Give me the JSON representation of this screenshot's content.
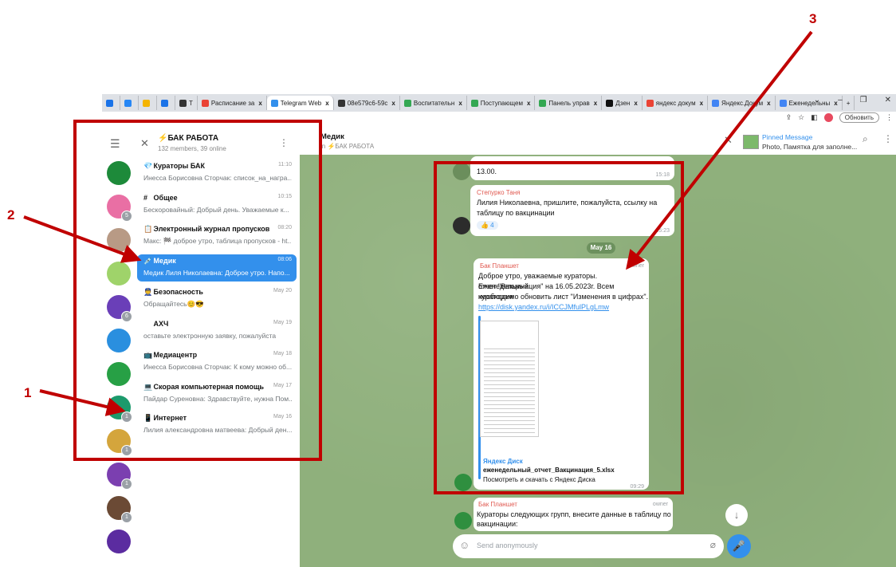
{
  "browser": {
    "tabs": [
      {
        "label": "",
        "color": "#1a73e8"
      },
      {
        "label": "",
        "color": "#2787f5"
      },
      {
        "label": "",
        "color": "#f4b400"
      },
      {
        "label": "",
        "color": "#1a73e8"
      },
      {
        "label": "T",
        "color": "#333333"
      },
      {
        "label": "Расписание за",
        "color": "#ea4335"
      },
      {
        "label": "Telegram Web",
        "color": "#3390ec",
        "active": true
      },
      {
        "label": "08e579c6-59c",
        "color": "#333333"
      },
      {
        "label": "Воспитательн",
        "color": "#34a853"
      },
      {
        "label": "Поступающем",
        "color": "#34a853"
      },
      {
        "label": "Панель управ",
        "color": "#34a853"
      },
      {
        "label": "Дзен",
        "color": "#111111"
      },
      {
        "label": "яндекс докум",
        "color": "#ea4335"
      },
      {
        "label": "Яндекс.Докум",
        "color": "#4285f4"
      },
      {
        "label": "Еженедельны",
        "color": "#4285f4"
      }
    ],
    "new_tab": "+",
    "update_label": "Обновить"
  },
  "sidebar": {
    "avatars": [
      {
        "color": "#1d8a3a",
        "badge": ""
      },
      {
        "color": "#e96fa4",
        "badge": "5"
      },
      {
        "color": "#b89a85",
        "badge": ""
      },
      {
        "color": "#9fd36a",
        "badge": ""
      },
      {
        "color": "#6a3fb8",
        "badge": "6"
      },
      {
        "color": "#2a8fdf",
        "badge": ""
      },
      {
        "color": "#27a045",
        "badge": ""
      },
      {
        "color": "#1c9a6c",
        "badge": "1"
      },
      {
        "color": "#d4a53c",
        "badge": "1"
      },
      {
        "color": "#7b3fb0",
        "badge": "1"
      },
      {
        "color": "#6b4a35",
        "badge": "1"
      },
      {
        "color": "#5b2ca0",
        "badge": ""
      }
    ]
  },
  "group": {
    "title": "⚡БАК РАБОТА",
    "subtitle": "132 members, 39 online"
  },
  "chats": [
    {
      "icon": "💎",
      "name": "Кураторы БАК",
      "time": "11:10",
      "preview": "Инесса Борисовна Сторчак: список_на_награ..."
    },
    {
      "icon": "#",
      "name": "Общее",
      "time": "10:15",
      "preview": "Бескоровайный: Добрый день. Уважаемые к..."
    },
    {
      "icon": "📋",
      "name": "Электронный журнал пропусков",
      "time": "08:20",
      "preview": "Макс: 🏁 доброе утро, таблица пропусков - ht..."
    },
    {
      "icon": "💉",
      "name": "Медик",
      "time": "08:06",
      "preview": "Медик Лиля Николаевна: Доброе утро. Напо...",
      "selected": true
    },
    {
      "icon": "👮",
      "name": "Безопасность",
      "time": "May 20",
      "preview": "Обращайтесь😊😎"
    },
    {
      "icon": "",
      "name": "АХЧ",
      "time": "May 19",
      "preview": "оставьте электронную заявку, пожалуйста"
    },
    {
      "icon": "📺",
      "name": "Медиацентр",
      "time": "May 18",
      "preview": "Инесса Борисовна Сторчак: К кому можно об..."
    },
    {
      "icon": "💻",
      "name": "Скорая компьютерная помощь",
      "time": "May 17",
      "preview": "Пайдар Суреновна: Здравствуйте, нужна Пом..."
    },
    {
      "icon": "📱",
      "name": "Интернет",
      "time": "May 16",
      "preview": "Лилия александровна матвеева: Добрый ден..."
    }
  ],
  "chat_header": {
    "title": "Медик",
    "subtitle": "in ⚡БАК РАБОТА",
    "pinned_title": "Pinned Message",
    "pinned_text": "Photo, Памятка для заполне..."
  },
  "messages": {
    "m1": {
      "text": "13.00.",
      "time": "15:18"
    },
    "m2": {
      "sender": "Степурко Таня",
      "line1": "Лилия Николаевна, пришлите, пожалуйста, ссылку на",
      "line2": "таблицу по вакцинации",
      "reaction": "👍 4",
      "time": "15:23"
    },
    "date": "May 16",
    "m3": {
      "sender": "Бак Планшет",
      "role": "owner",
      "line1": "Доброе утро, уважаемые кураторы. Еженедельный",
      "line2": "отчет \"Вакцинация\" на 16.05.2023г. Всем кураторам",
      "line3": "необходимо обновить лист \"Изменения в цифрах\".",
      "link": "https://disk.yandex.ru/i/ICCJMfulPLgLmw",
      "site": "Яндекс Диск",
      "file": "еженедельный_отчет_Вакцинация_5.xlsx",
      "file_desc": "Посмотреть и скачать с Яндекс Диска",
      "time": "09:29"
    },
    "m4": {
      "sender": "Бак Планшет",
      "role": "owner",
      "line1": "Кураторы следующих групп, внесите данные в таблицу по",
      "line2": "вакцинации:"
    }
  },
  "composer": {
    "placeholder": "Send anonymously"
  },
  "annotations": {
    "n1": "1",
    "n2": "2",
    "n3": "3",
    "color": "#c00000"
  }
}
